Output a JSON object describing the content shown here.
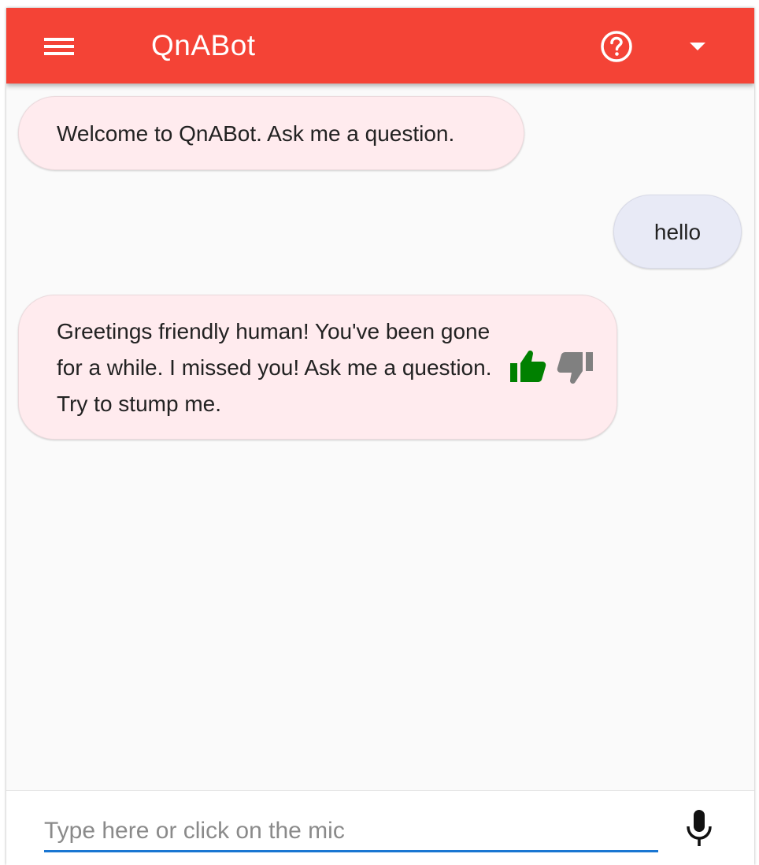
{
  "header": {
    "title": "QnABot",
    "color": "#f44336"
  },
  "icons": {
    "menu": "hamburger-menu-icon",
    "help": "help-circle-icon",
    "dropdown": "caret-down-icon",
    "thumb_up": "thumb-up-icon",
    "thumb_down": "thumb-down-icon",
    "mic": "microphone-icon"
  },
  "messages": [
    {
      "sender": "bot",
      "text": "Welcome to QnABot. Ask me a question."
    },
    {
      "sender": "user",
      "text": "hello"
    },
    {
      "sender": "bot",
      "text": "Greetings friendly human! You've been gone for a while. I missed you! Ask me a question. Try to stump me."
    }
  ],
  "feedback": {
    "thumb_up_color": "#008000",
    "thumb_down_color": "#808080"
  },
  "input": {
    "value": "",
    "placeholder": "Type here or click on the mic",
    "underline_color": "#1976d2"
  }
}
